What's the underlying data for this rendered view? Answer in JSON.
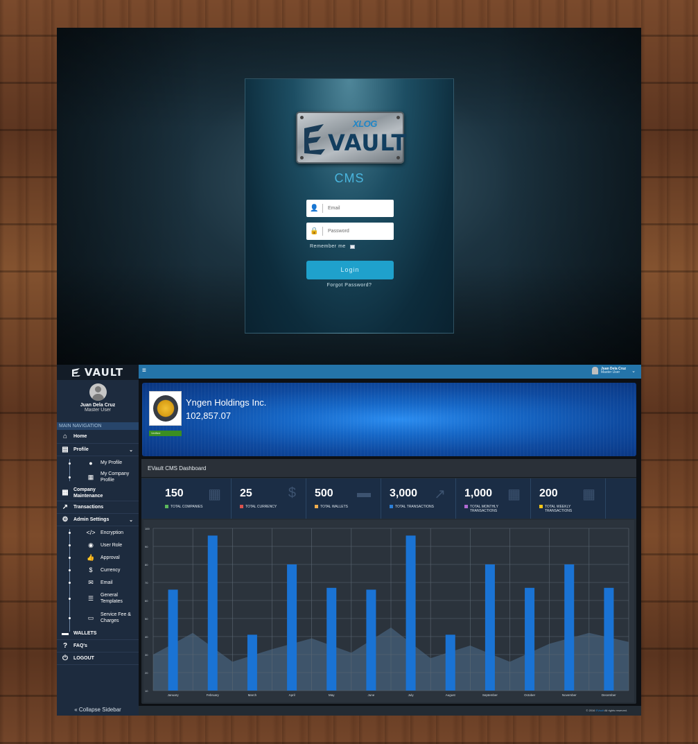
{
  "login": {
    "logo_small": "XLOG",
    "logo_text": "VAULT",
    "app_title": "CMS",
    "email_placeholder": "Email",
    "password_placeholder": "Password",
    "remember_label": "Remember me",
    "login_button": "Login",
    "forgot_link": "Forgot Password?"
  },
  "sidebar": {
    "brand": "VAULT",
    "user_name": "Juan Dela Cruz",
    "user_role": "Master User",
    "nav_header": "MAIN NAVIGATION",
    "items": [
      {
        "label": "Home",
        "icon": "home-icon"
      },
      {
        "label": "Profile",
        "icon": "id-card-icon"
      },
      {
        "label": "My Profile",
        "icon": "user-icon"
      },
      {
        "label": "My Company Profile",
        "icon": "building-icon"
      },
      {
        "label": "Company Maintenance",
        "icon": "building-icon"
      },
      {
        "label": "Transactions",
        "icon": "chart-line-icon"
      },
      {
        "label": "Admin Settings",
        "icon": "gears-icon"
      },
      {
        "label": "Encryption",
        "icon": "code-icon"
      },
      {
        "label": "User Role",
        "icon": "user-circle-icon"
      },
      {
        "label": "Approval",
        "icon": "thumbs-up-icon"
      },
      {
        "label": "Currency",
        "icon": "hand-dollar-icon"
      },
      {
        "label": "Email",
        "icon": "envelope-icon"
      },
      {
        "label": "General Templates",
        "icon": "sliders-icon"
      },
      {
        "label": "Service Fee & Charges",
        "icon": "money-bill-icon"
      },
      {
        "label": "WALLETS",
        "icon": "wallet-icon"
      },
      {
        "label": "FAQ's",
        "icon": "question-icon"
      },
      {
        "label": "LOGOUT",
        "icon": "power-icon"
      }
    ],
    "collapse_label": "Collapse Sidebar"
  },
  "topbar": {
    "user_name": "Juan Dela Cruz",
    "user_role": "Master User"
  },
  "company": {
    "name": "Yngen Holdings Inc.",
    "balance": "102,857.07",
    "verified_label": "Verified"
  },
  "dashboard": {
    "title": "EVault CMS Dashboard",
    "stats": [
      {
        "value": "150",
        "label": "TOTAL COMPANIES",
        "color": "#5cb85c",
        "icon": "building-icon"
      },
      {
        "value": "25",
        "label": "TOTAL CURRENCY",
        "color": "#d9534f",
        "icon": "hand-dollar-icon"
      },
      {
        "value": "500",
        "label": "TOTAL WALLETS",
        "color": "#f0ad4e",
        "icon": "wallet-icon"
      },
      {
        "value": "3,000",
        "label": "TOTAL TRANSACTIONS",
        "color": "#2b7ed6",
        "icon": "chart-line-icon"
      },
      {
        "value": "1,000",
        "label": "TOTAL MONTHLY TRANSACTIONS",
        "color": "#b06ad1",
        "icon": "calendar-icon"
      },
      {
        "value": "200",
        "label": "TOTAL WEEKLY TRANSACTIONS",
        "color": "#f5c518",
        "icon": "calendar-icon"
      }
    ]
  },
  "chart_data": {
    "type": "bar",
    "title": "",
    "xlabel": "",
    "ylabel": "",
    "ylim": [
      10,
      100
    ],
    "grid": true,
    "categories": [
      "January",
      "February",
      "March",
      "April",
      "May",
      "June",
      "July",
      "August",
      "September",
      "October",
      "November",
      "December"
    ],
    "series": [
      {
        "values": [
          66,
          96,
          41,
          80,
          67,
          66,
          96,
          41,
          80,
          67,
          80,
          67
        ]
      }
    ],
    "area_values": [
      30,
      42,
      26,
      33,
      39,
      31,
      45,
      28,
      35,
      26,
      36,
      42,
      37
    ],
    "yticks": [
      10,
      20,
      30,
      40,
      50,
      60,
      70,
      80,
      90,
      100
    ],
    "bar_color": "#1a73d4",
    "area_color": "#4f6f90"
  },
  "footer": {
    "copyright": "© 2016",
    "brand": "EVault",
    "rights": "All rights reserved."
  }
}
